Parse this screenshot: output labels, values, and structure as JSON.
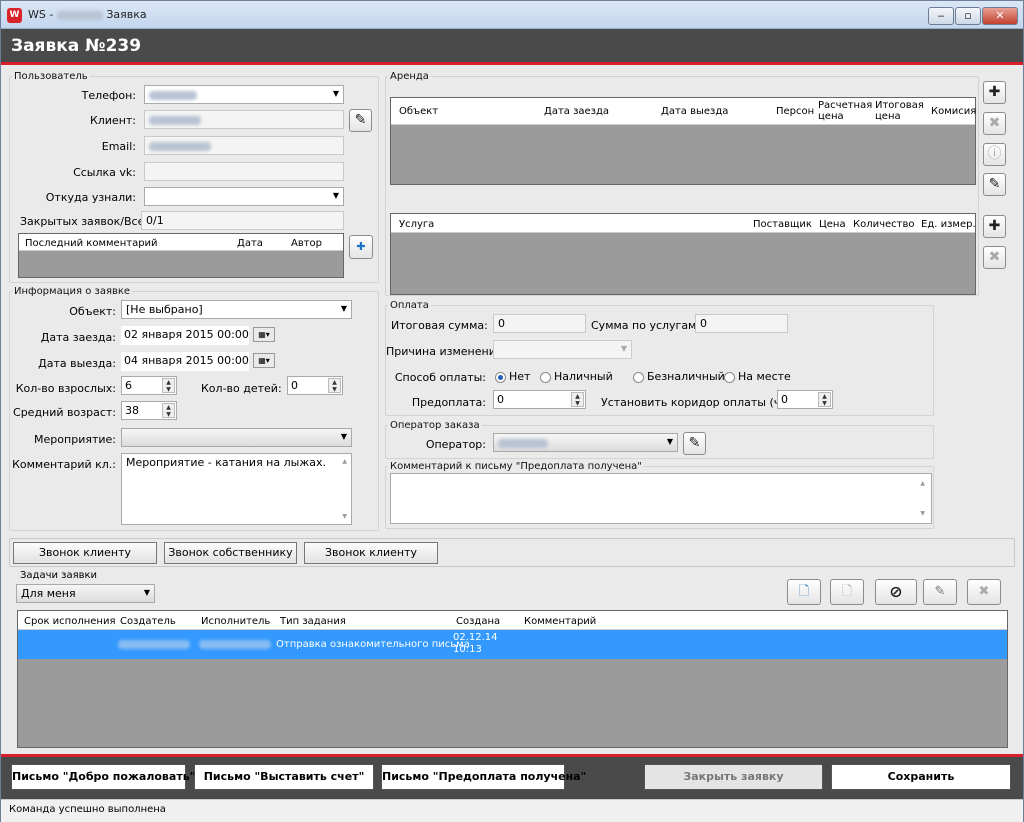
{
  "window": {
    "title_prefix": "WS -",
    "title_suffix": "Заявка",
    "min": "‒",
    "max": "▫",
    "close": "✕"
  },
  "header": {
    "title": "Заявка №239"
  },
  "user": {
    "legend": "Пользователь",
    "phone_label": "Телефон:",
    "client_label": "Клиент:",
    "email_label": "Email:",
    "vk_label": "Ссылка vk:",
    "source_label": "Откуда узнали:",
    "closed_label": "Закрытых заявок/Всего:",
    "closed_value": "0/1",
    "comments_headers": [
      "Последний комментарий",
      "Дата",
      "Автор"
    ]
  },
  "order_info": {
    "legend": "Информация о заявке",
    "object_label": "Объект:",
    "object_value": "[Не выбрано]",
    "checkin_label": "Дата заезда:",
    "checkin_value": "02  января  2015 00:00",
    "checkout_label": "Дата выезда:",
    "checkout_value": "04  января  2015 00:00",
    "adults_label": "Кол-во взрослых:",
    "adults_value": "6",
    "children_label": "Кол-во детей:",
    "children_value": "0",
    "age_label": "Средний возраст:",
    "age_value": "38",
    "event_label": "Мероприятие:",
    "client_comment_label": "Комментарий кл.:",
    "client_comment_value": "Мероприятие - катания на лыжах."
  },
  "rent": {
    "legend": "Аренда",
    "headers": [
      "Объект",
      "Дата заезда",
      "Дата выезда",
      "Персон",
      "Расчетная цена",
      "Итоговая цена",
      "Комисия"
    ]
  },
  "services": {
    "headers": [
      "Услуга",
      "Поставщик",
      "Цена",
      "Количество",
      "Ед. измер."
    ]
  },
  "payment": {
    "legend": "Оплата",
    "total_label": "Итоговая сумма:",
    "total_value": "0",
    "services_sum_label": "Сумма по услугам:",
    "services_sum_value": "0",
    "reason_label": "Причина изменений:",
    "method_label": "Способ оплаты:",
    "methods": [
      "Нет",
      "Наличный",
      "Безналичный",
      "На месте"
    ],
    "prepay_label": "Предоплата:",
    "prepay_value": "0",
    "corridor_label": "Установить коридор оплаты (ч.):",
    "corridor_value": "0"
  },
  "operator": {
    "legend": "Оператор заказа",
    "label": "Оператор:"
  },
  "letter_comment": {
    "legend": "Комментарий к письму \"Предоплата получена\""
  },
  "calls": [
    "Звонок клиенту",
    "Звонок собственнику",
    "Звонок клиенту"
  ],
  "tasks": {
    "legend": "Задачи заявки",
    "filter": "Для меня",
    "headers": [
      "Срок исполнения",
      "Создатель",
      "Исполнитель",
      "Тип задания",
      "Создана",
      "Комментарий"
    ],
    "row": {
      "type": "Отправка ознакомительного письма",
      "created_date": "02.12.14",
      "created_time": "10:13"
    }
  },
  "footer": {
    "welcome": "Письмо \"Добро пожаловать\"",
    "invoice": "Письмо \"Выставить счет\"",
    "prepaid": "Письмо \"Предоплата получена\"",
    "close": "Закрыть заявку",
    "save": "Сохранить"
  },
  "status": {
    "text": "Команда успешно выполнена"
  }
}
